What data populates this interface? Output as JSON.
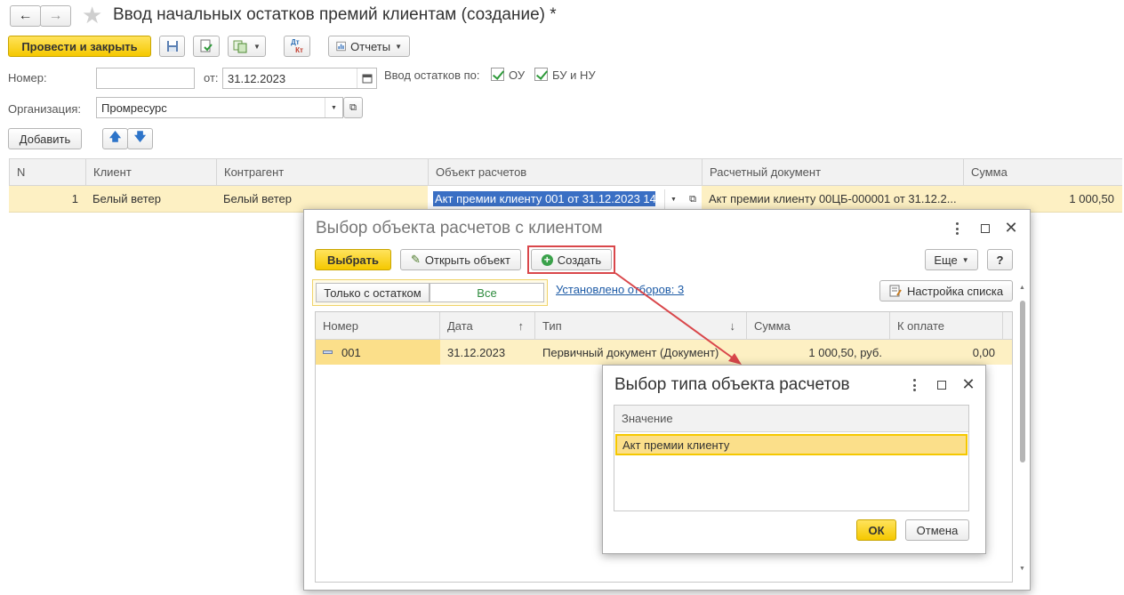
{
  "window": {
    "title": "Ввод начальных остатков премий клиентам (создание) *"
  },
  "toolbar": {
    "post_close": "Провести и закрыть",
    "reports": "Отчеты",
    "dtkt_top": "Дт",
    "dtkt_bottom": "Кт"
  },
  "form": {
    "number_label": "Номер:",
    "number_value": "",
    "date_label": "от:",
    "date_value": "31.12.2023",
    "balance_label": "Ввод остатков по:",
    "check_ou": "ОУ",
    "check_bu": "БУ и НУ",
    "org_label": "Организация:",
    "org_value": "Промресурс",
    "add_button": "Добавить"
  },
  "table": {
    "columns": [
      "N",
      "Клиент",
      "Контрагент",
      "Объект расчетов",
      "Расчетный документ",
      "Сумма"
    ],
    "rows": [
      {
        "n": "1",
        "client": "Белый ветер",
        "counterparty": "Белый ветер",
        "object": "Акт премии клиенту 001 от 31.12.2023 14:",
        "document": "Акт премии клиенту 00ЦБ-000001 от 31.12.2...",
        "sum": "1 000,50"
      }
    ]
  },
  "dialog1": {
    "title": "Выбор объекта расчетов с клиентом",
    "select_button": "Выбрать",
    "open_button": "Открыть объект",
    "create_button": "Создать",
    "more_button": "Еще",
    "help_button": "?",
    "filter_label": "Только с остатком",
    "filter_value": "Все",
    "filters_link": "Установлено отборов: 3",
    "list_settings": "Настройка списка",
    "columns": [
      "Номер",
      "Дата",
      "Тип",
      "Сумма",
      "К оплате"
    ],
    "rows": [
      {
        "number": "001",
        "date": "31.12.2023",
        "type": "Первичный документ (Документ)",
        "sum": "1 000,50, руб.",
        "to_pay": "0,00"
      }
    ]
  },
  "dialog2": {
    "title": "Выбор типа объекта расчетов",
    "column": "Значение",
    "items": [
      "Акт премии клиенту"
    ],
    "ok_button": "ОК",
    "cancel_button": "Отмена"
  },
  "colors": {
    "accent_yellow": "#f5c800",
    "selection_row": "#fdf0c3",
    "highlight_red": "#d9474b",
    "link_blue": "#1c5aa6"
  }
}
